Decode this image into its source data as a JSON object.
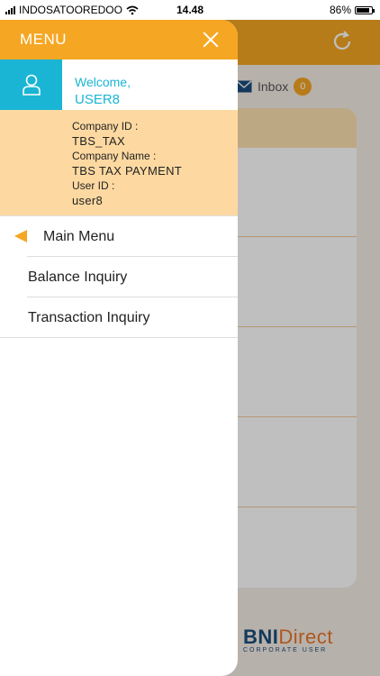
{
  "status_bar": {
    "carrier": "INDOSATOOREDOO",
    "time": "14.48",
    "battery": "86%",
    "battery_level": 0.86
  },
  "background": {
    "inbox_label": "Inbox",
    "inbox_count": "0",
    "logo_main": "BNI",
    "logo_direct": "Direct",
    "logo_sub": "CORPORATE USER"
  },
  "drawer": {
    "title": "MENU",
    "welcome": "Welcome,",
    "user": "USER8",
    "info": {
      "company_id_label": "Company ID :",
      "company_id": "TBS_TAX",
      "company_name_label": "Company Name :",
      "company_name": "TBS TAX PAYMENT",
      "user_id_label": "User ID :",
      "user_id": "user8"
    },
    "menu": {
      "main": "Main Menu",
      "items": [
        {
          "label": "Balance Inquiry"
        },
        {
          "label": "Transaction Inquiry"
        }
      ]
    }
  },
  "colors": {
    "accent": "#f5a623",
    "cyan": "#1ab5d4",
    "info_bg": "#fdd9a1"
  }
}
